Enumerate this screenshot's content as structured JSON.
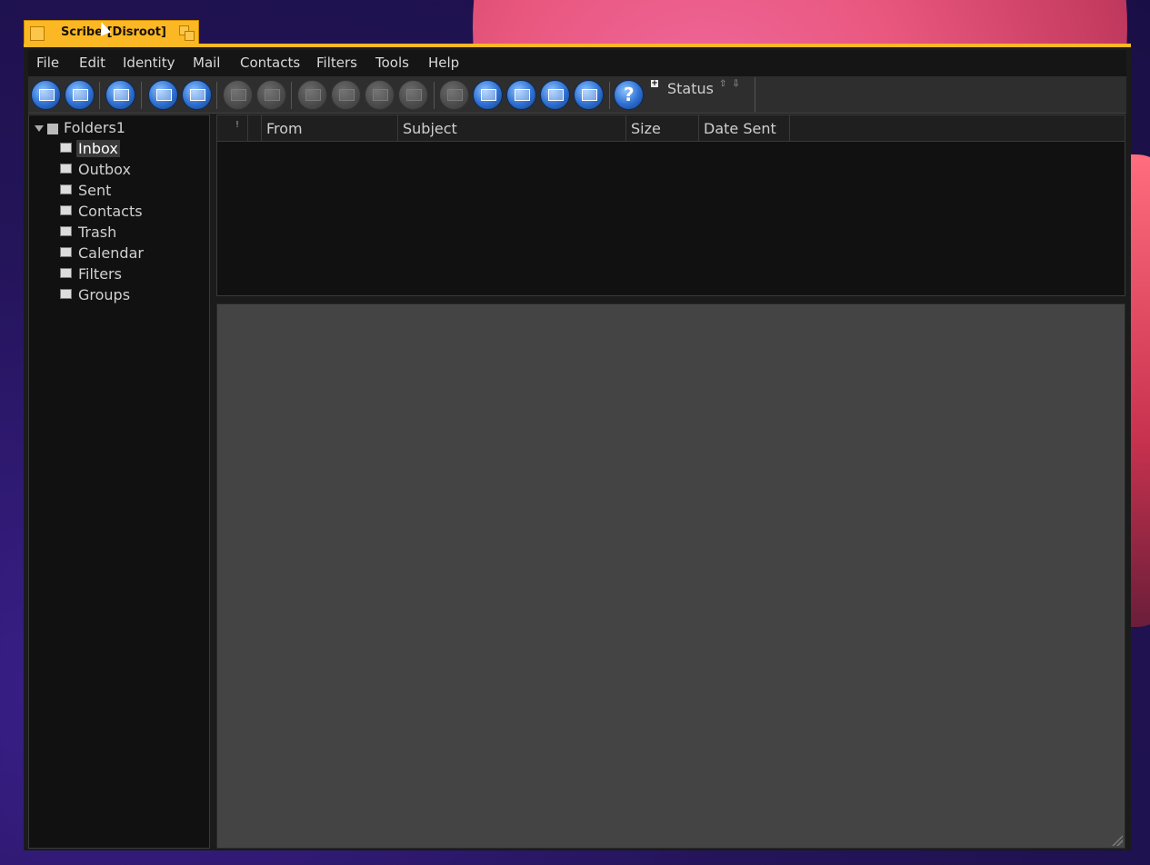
{
  "window": {
    "title": "Scribe [Disroot]"
  },
  "menubar": {
    "items": [
      "File",
      "Edit",
      "Identity",
      "Mail",
      "Contacts",
      "Filters",
      "Tools",
      "Help"
    ]
  },
  "toolbar": {
    "buttons": [
      {
        "icon": "new-mail-icon",
        "enabled": true
      },
      {
        "icon": "address-book-icon",
        "enabled": true
      },
      {
        "icon": "new-identity-icon",
        "enabled": true
      },
      {
        "icon": "receive-mail-icon",
        "enabled": true
      },
      {
        "icon": "preview-mail-icon",
        "enabled": true
      },
      {
        "icon": "delete-icon",
        "enabled": false
      },
      {
        "icon": "delete-spam-icon",
        "enabled": false
      },
      {
        "icon": "reply-icon",
        "enabled": false
      },
      {
        "icon": "reply-all-icon",
        "enabled": false
      },
      {
        "icon": "forward-icon",
        "enabled": false
      },
      {
        "icon": "bounce-icon",
        "enabled": false
      },
      {
        "icon": "archive-icon",
        "enabled": false
      },
      {
        "icon": "calendar-icon",
        "enabled": true
      },
      {
        "icon": "search-icon",
        "enabled": true
      },
      {
        "icon": "print-icon",
        "enabled": true
      },
      {
        "icon": "notes-icon",
        "enabled": true
      },
      {
        "icon": "help-icon",
        "enabled": true
      }
    ],
    "status_label": "Status",
    "status_arrows": "⇧⇩"
  },
  "tree": {
    "root": "Folders1",
    "folders": [
      {
        "label": "Inbox",
        "icon": "inbox-icon",
        "selected": true
      },
      {
        "label": "Outbox",
        "icon": "outbox-icon",
        "selected": false
      },
      {
        "label": "Sent",
        "icon": "sent-icon",
        "selected": false
      },
      {
        "label": "Contacts",
        "icon": "contacts-icon",
        "selected": false
      },
      {
        "label": "Trash",
        "icon": "trash-icon",
        "selected": false
      },
      {
        "label": "Calendar",
        "icon": "calendar-folder-icon",
        "selected": false
      },
      {
        "label": "Filters",
        "icon": "filters-icon",
        "selected": false
      },
      {
        "label": "Groups",
        "icon": "groups-icon",
        "selected": false
      }
    ]
  },
  "list": {
    "columns": [
      "!",
      "",
      "From",
      "Subject",
      "Size",
      "Date Sent"
    ]
  },
  "colors": {
    "accent": "#fbb824",
    "window_bg": "#1b1b1b",
    "preview_bg": "#444444"
  }
}
